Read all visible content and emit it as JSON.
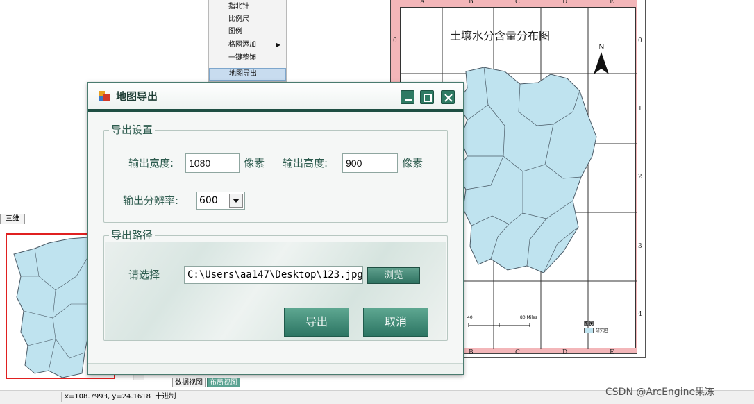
{
  "context_menu": {
    "items": [
      {
        "label": "指北针",
        "submenu": false,
        "highlighted": false
      },
      {
        "label": "比例尺",
        "submenu": false,
        "highlighted": false
      },
      {
        "label": "图例",
        "submenu": false,
        "highlighted": false
      },
      {
        "label": "格网添加",
        "submenu": true,
        "highlighted": false
      },
      {
        "label": "一键整饰",
        "submenu": false,
        "highlighted": false
      },
      {
        "label": "地图导出",
        "submenu": false,
        "highlighted": true
      }
    ]
  },
  "map_layout": {
    "title": "土壤水分含量分布图",
    "col_labels": [
      "A",
      "B",
      "C",
      "D",
      "E"
    ],
    "row_labels": [
      "0",
      "1",
      "2",
      "3",
      "4"
    ],
    "north_label": "N",
    "scale_labels": [
      "40",
      "80 Miles"
    ],
    "legend_title": "图例",
    "legend_item": "研究区",
    "fill_color": "#bfe3ef",
    "frame_color": "#f3b6b9"
  },
  "panel_tab_3d": "三维",
  "bottom_tabs": [
    {
      "label": "数据视图",
      "active": false
    },
    {
      "label": "布局视图",
      "active": true
    }
  ],
  "status_bar": {
    "coords": "x=108.7993, y=24.1618",
    "mode": "十进制"
  },
  "watermark": "CSDN @ArcEngine果冻",
  "dialog": {
    "title": "地图导出",
    "export_settings": {
      "group_label": "导出设置",
      "width_label": "输出宽度:",
      "width_value": "1080",
      "width_unit": "像素",
      "height_label": "输出高度:",
      "height_value": "900",
      "height_unit": "像素",
      "dpi_label": "输出分辨率:",
      "dpi_value": "600"
    },
    "export_path": {
      "group_label": "导出路径",
      "select_label": "请选择",
      "path_value": "C:\\Users\\aa147\\Desktop\\123.jpg",
      "browse_label": "浏览"
    },
    "export_button": "导出",
    "cancel_button": "取消"
  }
}
